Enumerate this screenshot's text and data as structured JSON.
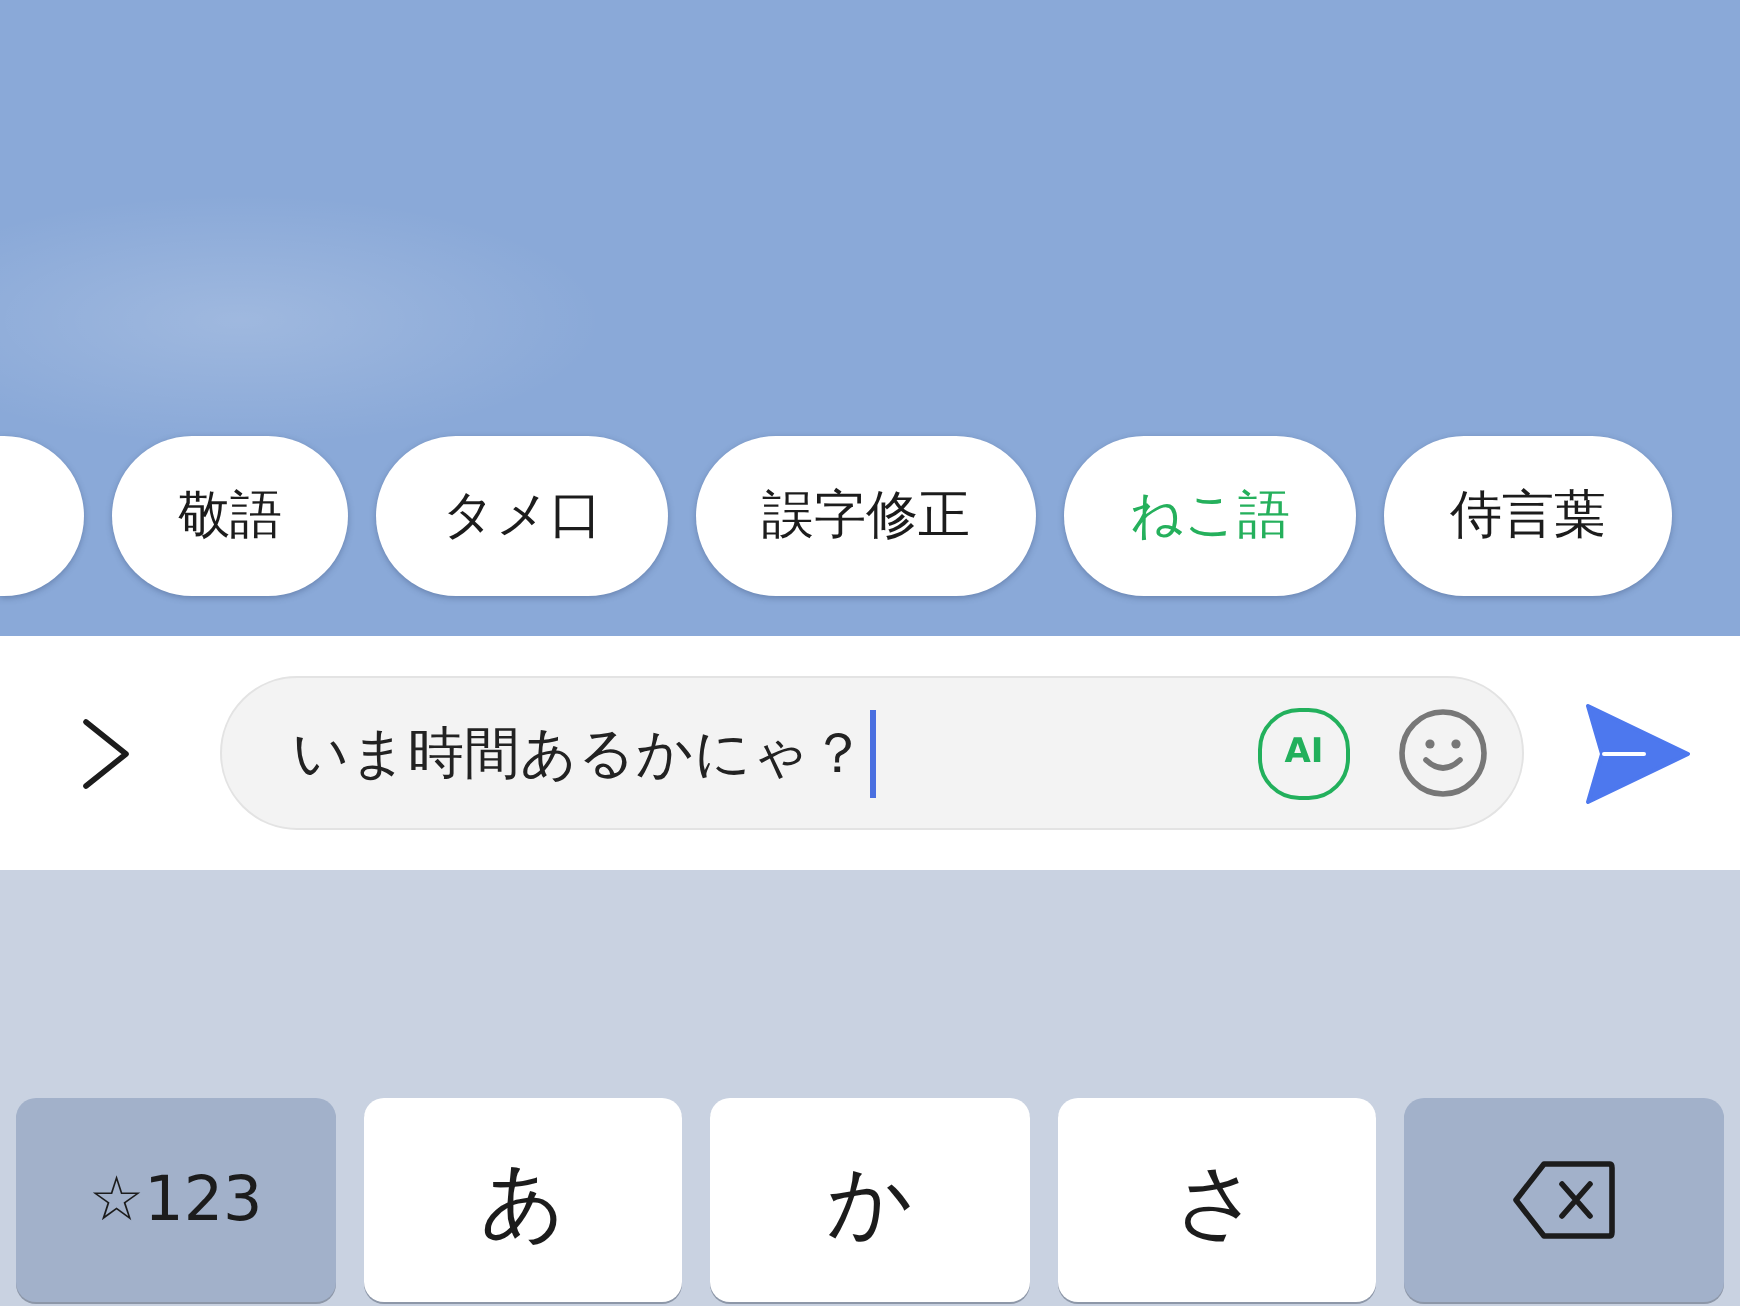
{
  "chip_row": {
    "cut_chip_left": true,
    "chips": [
      {
        "label": "敬語",
        "selected": false
      },
      {
        "label": "タメ口",
        "selected": false
      },
      {
        "label": "誤字修正",
        "selected": false
      },
      {
        "label": "ねこ語",
        "selected": true
      },
      {
        "label": "侍言葉",
        "selected": false
      }
    ]
  },
  "compose_bar": {
    "message_field": {
      "value": "いま時間あるかにゃ？",
      "focused": true
    },
    "ai_button": {
      "label": "AI"
    }
  },
  "keyboard": {
    "keys": [
      {
        "kind": "mode",
        "label": "☆123"
      },
      {
        "kind": "kana",
        "label": "あ"
      },
      {
        "kind": "kana",
        "label": "か"
      },
      {
        "kind": "kana",
        "label": "さ"
      },
      {
        "kind": "delete"
      }
    ]
  }
}
